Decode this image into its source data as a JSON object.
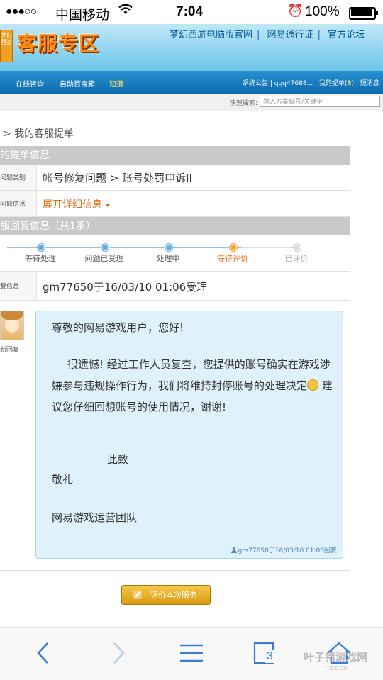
{
  "status_bar": {
    "signal": "●●●○○",
    "carrier": "中国移动",
    "time": "7:04",
    "battery": "100%"
  },
  "banner": {
    "logo_tag": "梦幻西游",
    "logo": "客服专区",
    "links": [
      "梦幻西游电脑版官网",
      "网易通行证",
      "官方论坛"
    ]
  },
  "navbar": {
    "items": [
      "在线咨询",
      "自助百宝箱",
      "知道"
    ],
    "right_text_1": "系统公告 | qqq47688... | 我的提单(",
    "right_count": "3",
    "right_text_2": ") | 短消息"
  },
  "search": {
    "label": "快速搜索:",
    "placeholder": "输入方案编号/关键字"
  },
  "breadcrumb": "> 我的客服提单",
  "ticket_info": {
    "section_title": "的提单信息",
    "category_label": "问题类别",
    "category_value": "帐号修复问题 > 账号处罚申诉II",
    "detail_label": "问题信息",
    "detail_link": "展开详细信息"
  },
  "reply_info": {
    "section_title": "服回复信息（共1条）",
    "steps": [
      "等待处理",
      "问题已受理",
      "处理中",
      "等待评价",
      "已评价"
    ],
    "current_step": 3,
    "reply_label": "复信息",
    "reply_value": "gm77650于16/03/10 01:06受理"
  },
  "reply": {
    "avatar_caption": "新回复",
    "greeting": "尊敬的网易游戏用户，您好!",
    "para_before_emoji": "很遗憾! 经过工作人员复查，您提供的账号确实在游戏涉嫌参与违规操作行为，我们将维持封停账号的处理决定",
    "para_after_emoji": " 建议您仔细回想账号的使用情况，谢谢!",
    "closing": "此致",
    "regards": "敬礼",
    "team": "网易游戏运营团队",
    "footer": "gm77650于16/03/10 01:06回复"
  },
  "rate_button": "评价本次服务",
  "toolbar": {
    "tab_count": "3"
  },
  "watermark": {
    "main": "叶子猪游戏网",
    "sub": "YZZ.CN"
  },
  "colors": {
    "nav_blue": "#0b6bb0",
    "accent_orange": "#e0701a",
    "bubble_bg": "#dff1fb"
  }
}
